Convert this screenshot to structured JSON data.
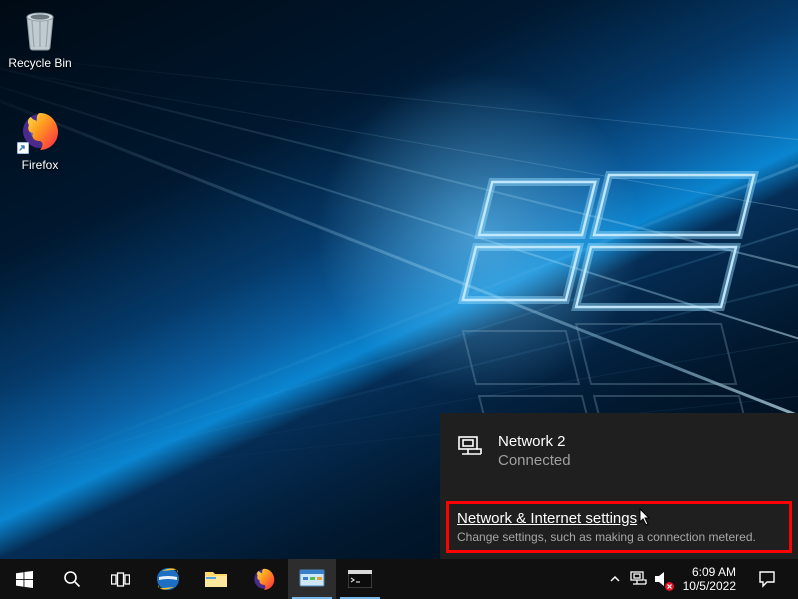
{
  "desktop": {
    "icons": {
      "recycle_bin": {
        "label": "Recycle Bin"
      },
      "firefox": {
        "label": "Firefox"
      }
    }
  },
  "flyout": {
    "network_name": "Network 2",
    "network_status": "Connected",
    "settings_title": "Network & Internet settings",
    "settings_subtitle": "Change settings, such as making a connection metered."
  },
  "taskbar": {
    "clock_time": "6:09 AM",
    "clock_date": "10/5/2022"
  }
}
